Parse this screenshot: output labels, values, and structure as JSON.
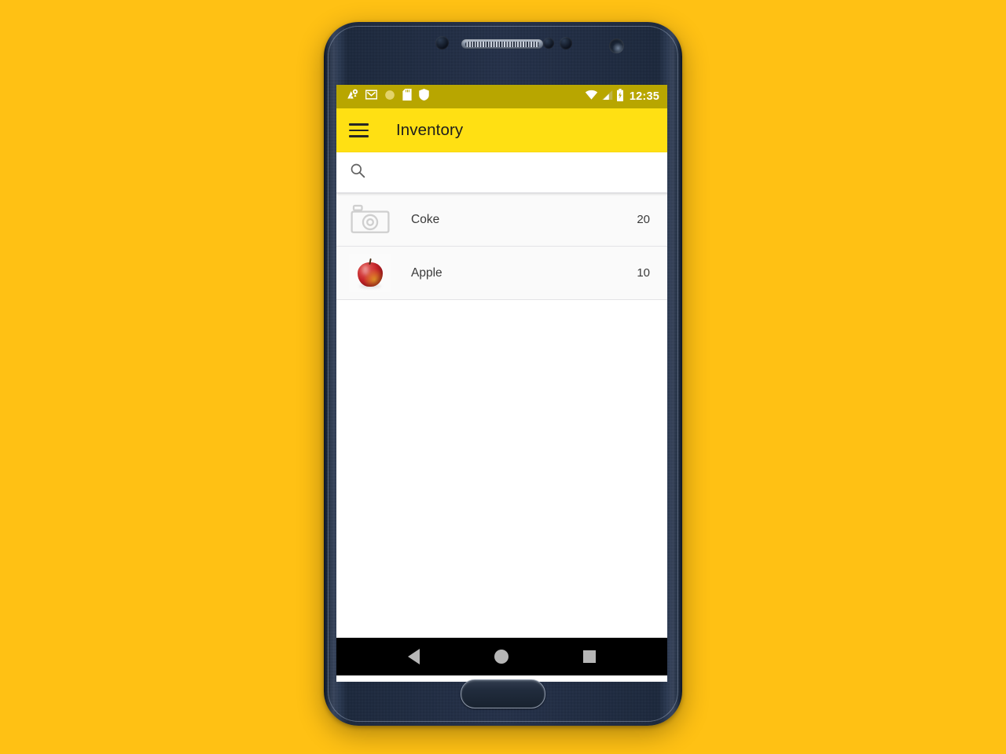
{
  "device": {
    "frame_name": "android-phone",
    "background_color": "#FFC114"
  },
  "status_bar": {
    "background_color": "#B8A600",
    "time": "12:35",
    "left_icons": [
      "maps-location-icon",
      "gmail-icon",
      "circle-icon",
      "sd-card-icon",
      "shield-icon"
    ],
    "right_icons": [
      "wifi-icon",
      "cellular-signal-icon",
      "battery-icon"
    ]
  },
  "app_bar": {
    "background_color": "#FFE013",
    "menu_label": "Menu",
    "title": "Inventory"
  },
  "search": {
    "icon": "search-icon",
    "value": "",
    "placeholder": ""
  },
  "inventory": {
    "items": [
      {
        "name": "Coke",
        "quantity": "20",
        "thumbnail": "camera-placeholder-icon"
      },
      {
        "name": "Apple",
        "quantity": "10",
        "thumbnail": "apple-photo"
      }
    ]
  },
  "nav_bar": {
    "background_color": "#000000",
    "buttons": [
      {
        "name": "back",
        "icon": "triangle-left-icon"
      },
      {
        "name": "home",
        "icon": "circle-icon"
      },
      {
        "name": "recents",
        "icon": "square-icon"
      }
    ]
  }
}
